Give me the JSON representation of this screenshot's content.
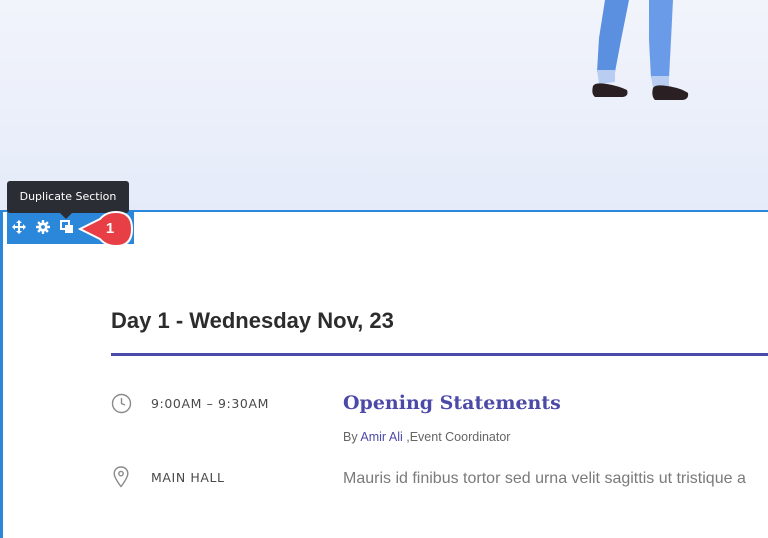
{
  "builder": {
    "tooltip": "Duplicate Section",
    "step_badge": "1",
    "toolbar_icons": [
      "move-icon",
      "gear-icon",
      "duplicate-icon"
    ],
    "accent_color": "#2b87da",
    "badge_color": "#e83e45"
  },
  "schedule": {
    "day_heading": "Day 1 - Wednesday Nov, 23",
    "accent_color": "#4c4aa8",
    "session": {
      "time": "9:00AM – 9:30AM",
      "location": "MAIN HALL",
      "title": "Opening Statements",
      "by_prefix": "By",
      "speaker": "Amir Ali",
      "speaker_role": ",Event Coordinator",
      "description": "Mauris id finibus tortor sed urna velit sagittis ut tristique a"
    }
  }
}
